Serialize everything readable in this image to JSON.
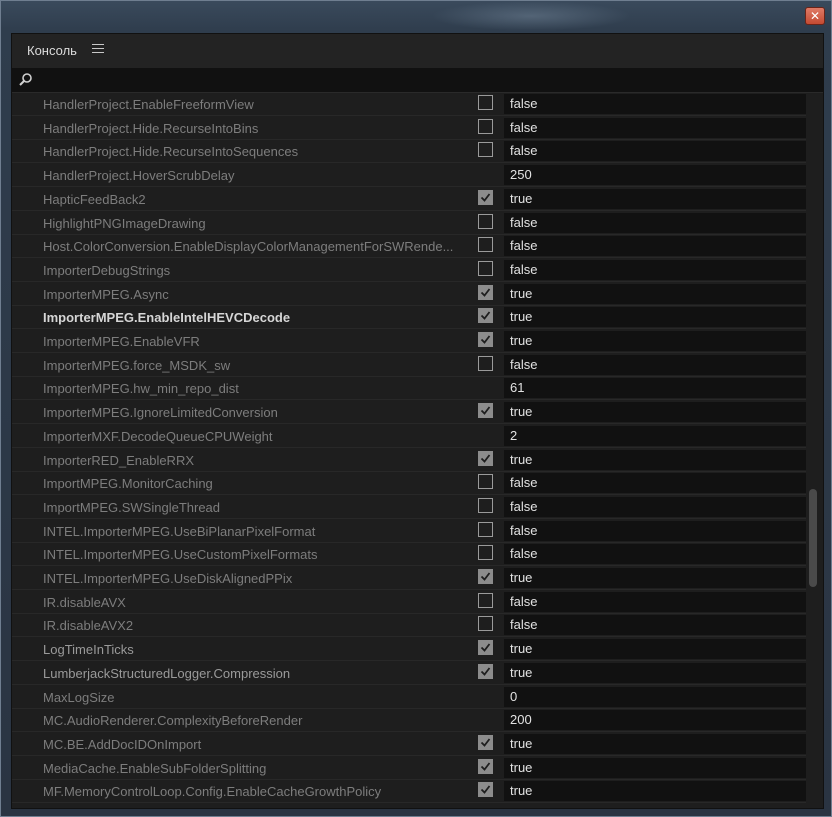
{
  "window": {
    "close_glyph": "✕"
  },
  "panel": {
    "title": "Консоль"
  },
  "search": {
    "value": "",
    "placeholder": ""
  },
  "rows": [
    {
      "name": "HandlerProject.EnableFreeformView",
      "checkbox": true,
      "checked": false,
      "value": "false",
      "style": "dim"
    },
    {
      "name": "HandlerProject.Hide.RecurseIntoBins",
      "checkbox": true,
      "checked": false,
      "value": "false",
      "style": "dim"
    },
    {
      "name": "HandlerProject.Hide.RecurseIntoSequences",
      "checkbox": true,
      "checked": false,
      "value": "false",
      "style": "dim"
    },
    {
      "name": "HandlerProject.HoverScrubDelay",
      "checkbox": false,
      "checked": false,
      "value": "250",
      "style": "dim"
    },
    {
      "name": "HapticFeedBack2",
      "checkbox": true,
      "checked": true,
      "value": "true",
      "style": "dim"
    },
    {
      "name": "HighlightPNGImageDrawing",
      "checkbox": true,
      "checked": false,
      "value": "false",
      "style": "dim"
    },
    {
      "name": "Host.ColorConversion.EnableDisplayColorManagementForSWRende...",
      "checkbox": true,
      "checked": false,
      "value": "false",
      "style": "dim"
    },
    {
      "name": "ImporterDebugStrings",
      "checkbox": true,
      "checked": false,
      "value": "false",
      "style": "dim"
    },
    {
      "name": "ImporterMPEG.Async",
      "checkbox": true,
      "checked": true,
      "value": "true",
      "style": "dim"
    },
    {
      "name": "ImporterMPEG.EnableIntelHEVCDecode",
      "checkbox": true,
      "checked": true,
      "value": "true",
      "style": "bold"
    },
    {
      "name": "ImporterMPEG.EnableVFR",
      "checkbox": true,
      "checked": true,
      "value": "true",
      "style": "dim"
    },
    {
      "name": "ImporterMPEG.force_MSDK_sw",
      "checkbox": true,
      "checked": false,
      "value": "false",
      "style": "dim"
    },
    {
      "name": "ImporterMPEG.hw_min_repo_dist",
      "checkbox": false,
      "checked": false,
      "value": "61",
      "style": "dim"
    },
    {
      "name": "ImporterMPEG.IgnoreLimitedConversion",
      "checkbox": true,
      "checked": true,
      "value": "true",
      "style": "dim"
    },
    {
      "name": "ImporterMXF.DecodeQueueCPUWeight",
      "checkbox": false,
      "checked": false,
      "value": "2",
      "style": "dim"
    },
    {
      "name": "ImporterRED_EnableRRX",
      "checkbox": true,
      "checked": true,
      "value": "true",
      "style": "dim"
    },
    {
      "name": "ImportMPEG.MonitorCaching",
      "checkbox": true,
      "checked": false,
      "value": "false",
      "style": "dim"
    },
    {
      "name": "ImportMPEG.SWSingleThread",
      "checkbox": true,
      "checked": false,
      "value": "false",
      "style": "dim"
    },
    {
      "name": "INTEL.ImporterMPEG.UseBiPlanarPixelFormat",
      "checkbox": true,
      "checked": false,
      "value": "false",
      "style": "dim"
    },
    {
      "name": "INTEL.ImporterMPEG.UseCustomPixelFormats",
      "checkbox": true,
      "checked": false,
      "value": "false",
      "style": "dim"
    },
    {
      "name": "INTEL.ImporterMPEG.UseDiskAlignedPPix",
      "checkbox": true,
      "checked": true,
      "value": "true",
      "style": "dim"
    },
    {
      "name": "IR.disableAVX",
      "checkbox": true,
      "checked": false,
      "value": "false",
      "style": "dim"
    },
    {
      "name": "IR.disableAVX2",
      "checkbox": true,
      "checked": false,
      "value": "false",
      "style": "dim"
    },
    {
      "name": "LogTimeInTicks",
      "checkbox": true,
      "checked": true,
      "value": "true",
      "style": "mid"
    },
    {
      "name": "LumberjackStructuredLogger.Compression",
      "checkbox": true,
      "checked": true,
      "value": "true",
      "style": "mid"
    },
    {
      "name": "MaxLogSize",
      "checkbox": false,
      "checked": false,
      "value": "0",
      "style": "dim"
    },
    {
      "name": "MC.AudioRenderer.ComplexityBeforeRender",
      "checkbox": false,
      "checked": false,
      "value": "200",
      "style": "dim"
    },
    {
      "name": "MC.BE.AddDocIDOnImport",
      "checkbox": true,
      "checked": true,
      "value": "true",
      "style": "dim"
    },
    {
      "name": "MediaCache.EnableSubFolderSplitting",
      "checkbox": true,
      "checked": true,
      "value": "true",
      "style": "dim"
    },
    {
      "name": "MF.MemoryControlLoop.Config.EnableCacheGrowthPolicy",
      "checkbox": true,
      "checked": true,
      "value": "true",
      "style": "dim"
    }
  ]
}
